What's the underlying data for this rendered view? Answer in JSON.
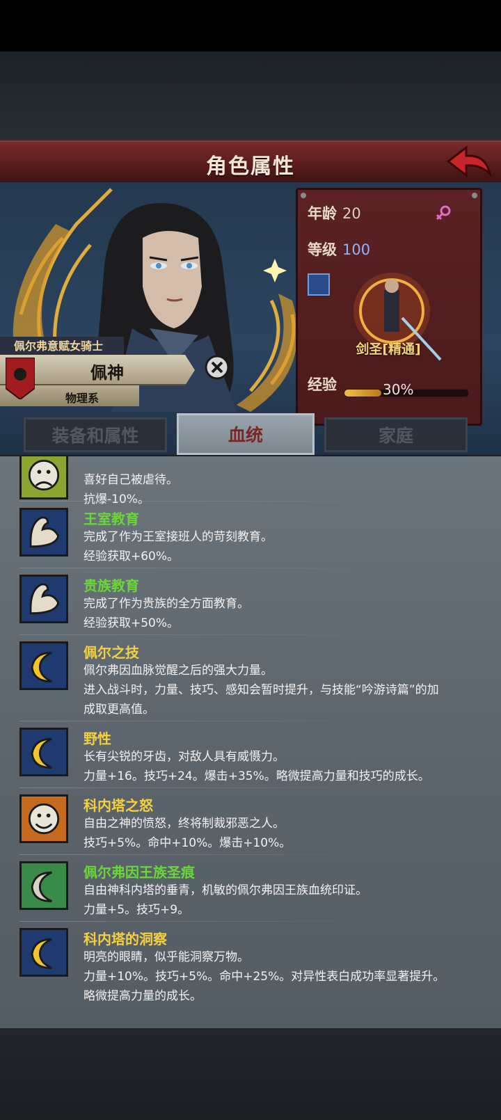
{
  "header": {
    "title": "角色属性"
  },
  "character": {
    "title": "佩尔弗意赋女骑士",
    "name": "佩神",
    "type": "物理系"
  },
  "stats": {
    "age_label": "年龄",
    "age_value": "20",
    "level_label": "等级",
    "level_value": "100",
    "class_name": "剑圣[精通]",
    "exp_label": "经验",
    "exp_value": "30%",
    "exp_fraction": 0.3
  },
  "tabs": [
    {
      "label": "装备和属性",
      "active": false
    },
    {
      "label": "血统",
      "active": true
    },
    {
      "label": "家庭",
      "active": false
    }
  ],
  "traits": [
    {
      "name": "",
      "desc": [
        "喜好自己被虐待。",
        "抗爆-10%。"
      ],
      "icon": "sad-face-icon",
      "color": "yellow"
    },
    {
      "name": "王室教育",
      "desc": [
        "完成了作为王室接班人的苛刻教育。",
        "经验获取+60%。"
      ],
      "icon": "muscle-arm-icon",
      "color": "green"
    },
    {
      "name": "贵族教育",
      "desc": [
        "完成了作为贵族的全方面教育。",
        "经验获取+50%。"
      ],
      "icon": "muscle-arm-icon",
      "color": "green"
    },
    {
      "name": "佩尔之技",
      "desc": [
        "佩尔弗因血脉觉醒之后的强大力量。",
        "进入战斗时，力量、技巧、感知会暂时提升，与技能“吟游诗篇”的加",
        "成取更高值。"
      ],
      "icon": "crescent-moon-icon",
      "color": "yellow"
    },
    {
      "name": "野性",
      "desc": [
        "长有尖锐的牙齿，对敌人具有威慑力。",
        "力量+16。技巧+24。爆击+35%。略微提高力量和技巧的成长。"
      ],
      "icon": "crescent-moon-icon",
      "color": "yellow"
    },
    {
      "name": "科内塔之怒",
      "desc": [
        "自由之神的愤怒，终将制裁邪恶之人。",
        "技巧+5%。命中+10%。爆击+10%。"
      ],
      "icon": "smile-face-icon",
      "color": "yellow"
    },
    {
      "name": "佩尔弗因王族圣痕",
      "desc": [
        "自由神科内塔的垂青，机敏的佩尔弗因王族血统印证。",
        "力量+5。技巧+9。"
      ],
      "icon": "crescent-moon-icon",
      "color": "green"
    },
    {
      "name": "科内塔的洞察",
      "desc": [
        "明亮的眼睛，似乎能洞察万物。",
        "力量+10%。技巧+5%。命中+25%。对异性表白成功率显著提升。",
        "略微提高力量的成长。"
      ],
      "icon": "crescent-moon-icon",
      "color": "yellow"
    }
  ]
}
